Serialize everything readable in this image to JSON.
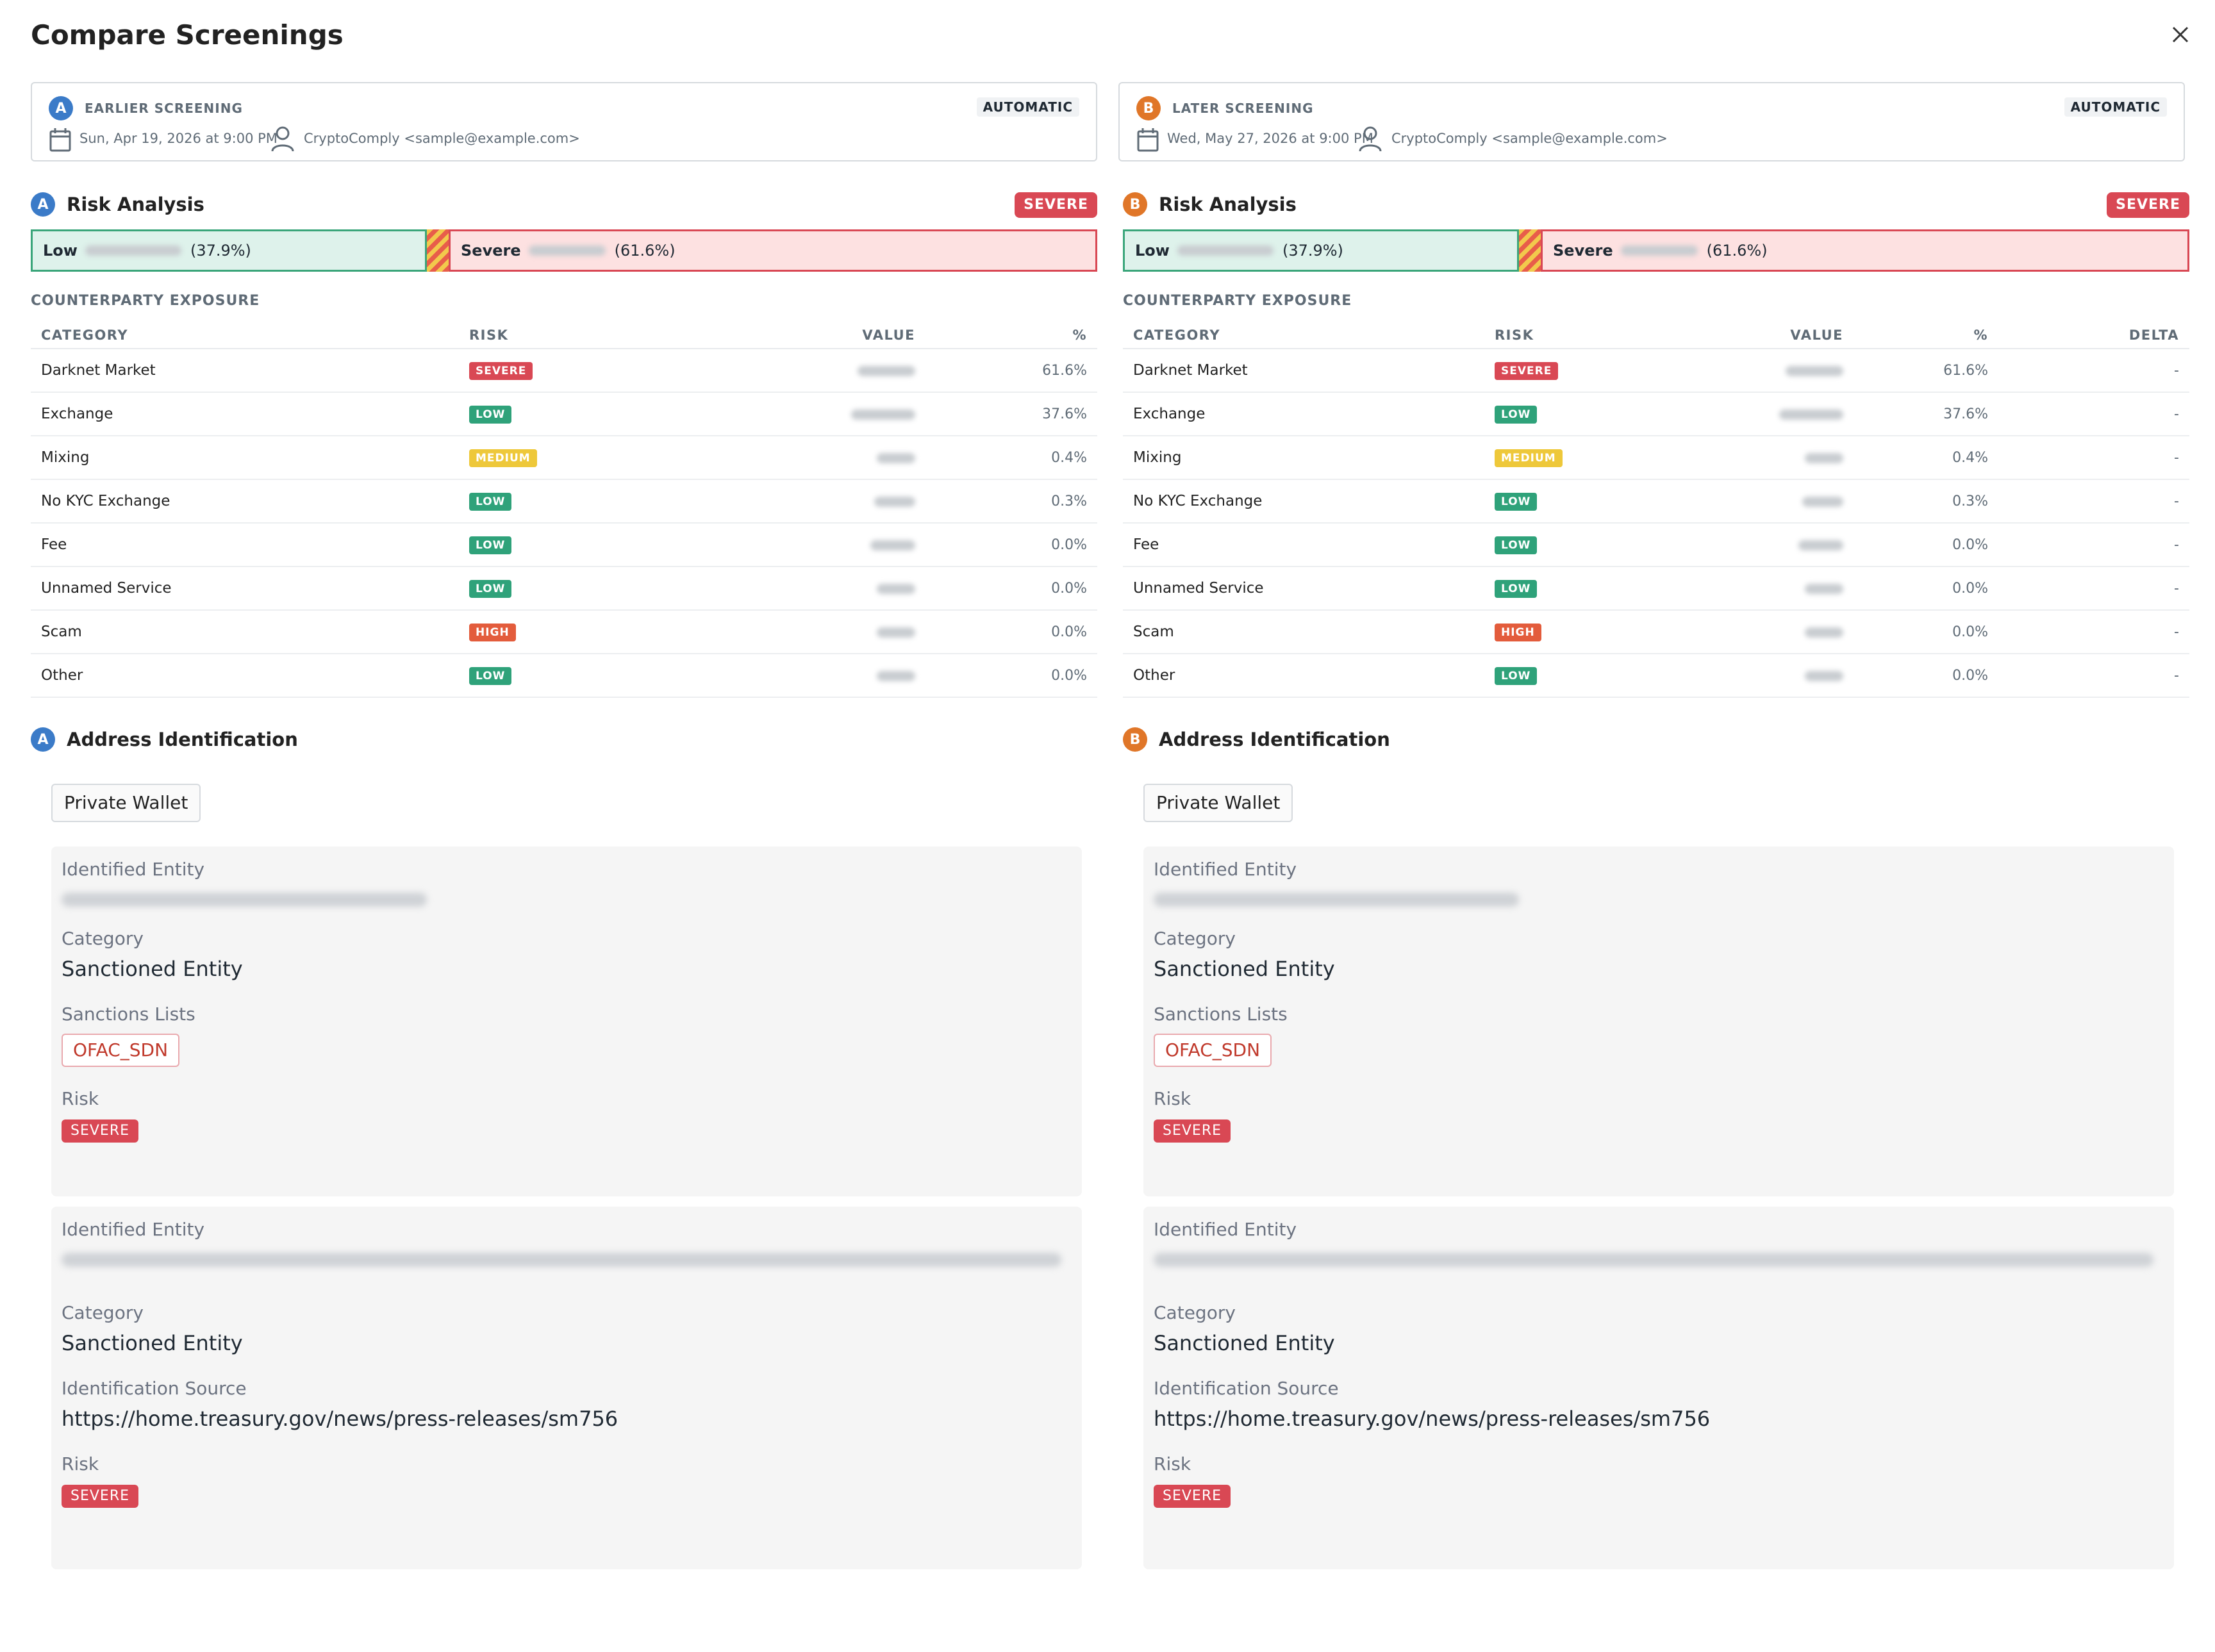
{
  "title": "Compare Screenings",
  "screening_a": {
    "badge": "A",
    "label": "EARLIER SCREENING",
    "mode": "AUTOMATIC",
    "date": "Sun, Apr 19, 2026 at 9:00 PM",
    "user": "CryptoComply <sample@example.com>"
  },
  "screening_b": {
    "badge": "B",
    "label": "LATER SCREENING",
    "mode": "AUTOMATIC",
    "date": "Wed, May 27, 2026 at 9:00 PM",
    "user": "CryptoComply <sample@example.com>"
  },
  "risk_analysis": {
    "title": "Risk Analysis",
    "overall": "SEVERE",
    "low_label": "Low",
    "low_pct": "(37.9%)",
    "low_fraction": 0.379,
    "severe_label": "Severe",
    "severe_pct": "(61.6%)",
    "severe_fraction": 0.616
  },
  "exposure": {
    "title": "COUNTERPARTY EXPOSURE",
    "headers": {
      "category": "CATEGORY",
      "risk": "RISK",
      "value": "VALUE",
      "pct": "%",
      "delta": "DELTA"
    },
    "rows": [
      {
        "category": "Darknet Market",
        "risk": "SEVERE",
        "pct": "61.6%",
        "delta": "-"
      },
      {
        "category": "Exchange",
        "risk": "LOW",
        "pct": "37.6%",
        "delta": "-"
      },
      {
        "category": "Mixing",
        "risk": "MEDIUM",
        "pct": "0.4%",
        "delta": "-"
      },
      {
        "category": "No KYC Exchange",
        "risk": "LOW",
        "pct": "0.3%",
        "delta": "-"
      },
      {
        "category": "Fee",
        "risk": "LOW",
        "pct": "0.0%",
        "delta": "-"
      },
      {
        "category": "Unnamed Service",
        "risk": "LOW",
        "pct": "0.0%",
        "delta": "-"
      },
      {
        "category": "Scam",
        "risk": "HIGH",
        "pct": "0.0%",
        "delta": "-"
      },
      {
        "category": "Other",
        "risk": "LOW",
        "pct": "0.0%",
        "delta": "-"
      }
    ]
  },
  "address_identification": {
    "title": "Address Identification",
    "wallet_type": "Private Wallet",
    "entity1": {
      "k_entity": "Identified Entity",
      "k_category": "Category",
      "category": "Sanctioned Entity",
      "k_lists": "Sanctions Lists",
      "list": "OFAC_SDN",
      "k_risk": "Risk",
      "risk": "SEVERE"
    },
    "entity2": {
      "k_entity": "Identified Entity",
      "k_category": "Category",
      "category": "Sanctioned Entity",
      "k_source": "Identification Source",
      "source": "https://home.treasury.gov/news/press-releases/sm756",
      "k_risk": "Risk",
      "risk": "SEVERE"
    }
  },
  "colors": {
    "badge_a": "#3b7bc8",
    "badge_b": "#e07628",
    "severe": "#d94854",
    "low": "#2fa27a",
    "medium": "#eec83a",
    "high": "#e35c3c"
  }
}
